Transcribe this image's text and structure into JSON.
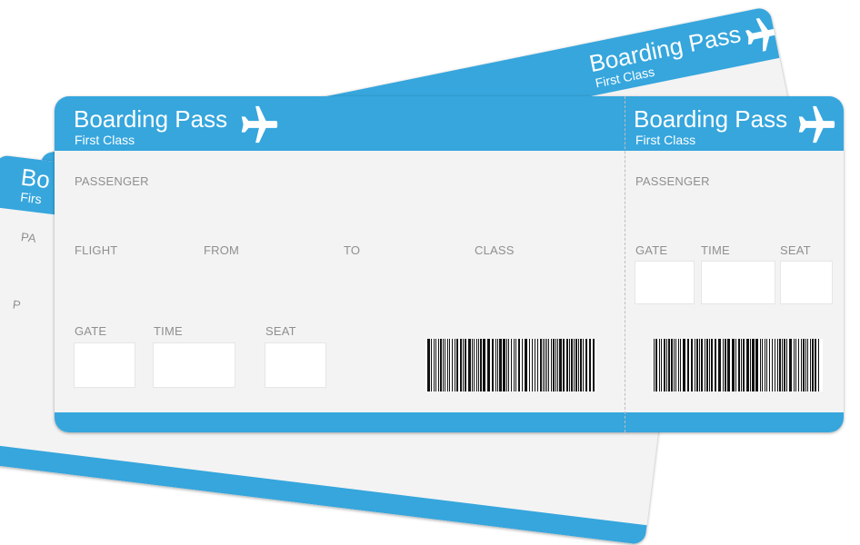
{
  "colors": {
    "accent": "#36a6dd",
    "ticket_bg": "#f3f3f3",
    "label": "#8f8f8f"
  },
  "back_ticket_right": {
    "title": "Boarding Pass",
    "subtitle": "First Class"
  },
  "back_ticket_left": {
    "title": "Bo",
    "subtitle": "Firs",
    "label_p": "PA",
    "label_p2": "P"
  },
  "main_ticket": {
    "title": "Boarding Pass",
    "subtitle": "First Class",
    "icon": "airplane-icon",
    "labels": {
      "passenger": "PASSENGER",
      "flight": "FLIGHT",
      "from": "FROM",
      "to": "TO",
      "class": "CLASS",
      "gate": "GATE",
      "time": "TIME",
      "seat": "SEAT"
    }
  },
  "stub": {
    "title": "Boarding Pass",
    "subtitle": "First Class",
    "icon": "airplane-icon",
    "labels": {
      "passenger": "PASSENGER",
      "gate": "GATE",
      "time": "TIME",
      "seat": "SEAT"
    }
  }
}
